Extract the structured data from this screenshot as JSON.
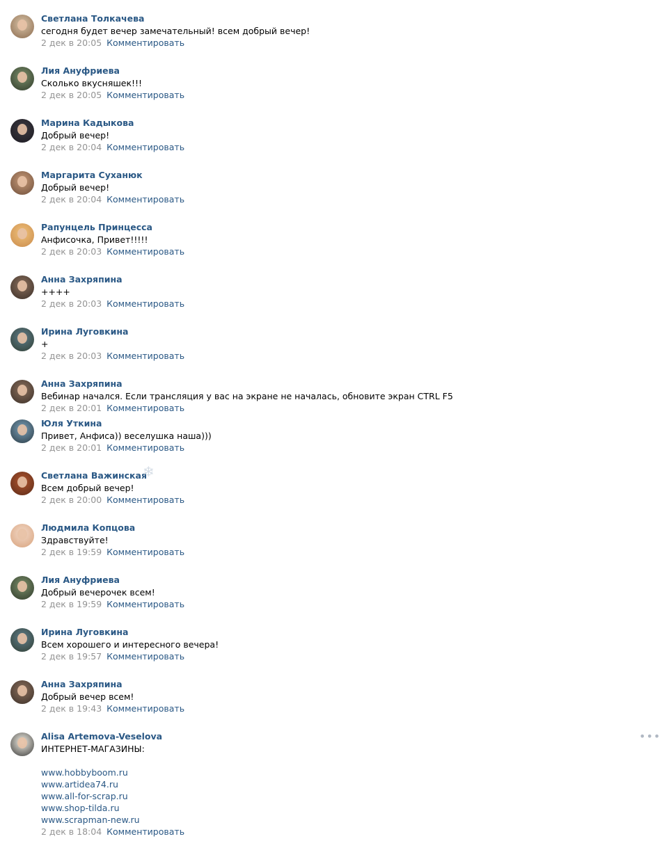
{
  "ui": {
    "reply_label": "Комментировать",
    "more_icon": "more-dots-icon",
    "decor_icon": "snowflake-icon"
  },
  "comments": [
    {
      "author": "Светлана Толкачева",
      "text": "сегодня будет вечер замечательный! всем добрый вечер!",
      "date": "2 дек в 20:05",
      "avatar_colors": [
        "#d9c4a8",
        "#8a6a4e"
      ]
    },
    {
      "author": "Лия Ануфриева",
      "text": "Сколько вкусняшек!!!",
      "date": "2 дек в 20:05",
      "avatar_colors": [
        "#7b8f6a",
        "#2f3a2a"
      ]
    },
    {
      "author": "Марина Кадыкова",
      "text": "Добрый вечер!",
      "date": "2 дек в 20:04",
      "avatar_colors": [
        "#3c3a40",
        "#1c1a22"
      ]
    },
    {
      "author": "Маргарита Суханюк",
      "text": "Добрый вечер!",
      "date": "2 дек в 20:04",
      "avatar_colors": [
        "#c79a78",
        "#6e4e3a"
      ]
    },
    {
      "author": "Рапунцель Принцесса",
      "text": "Анфисочка, Привет!!!!!",
      "date": "2 дек в 20:03",
      "avatar_colors": [
        "#f0c27b",
        "#c98a4b"
      ]
    },
    {
      "author": "Анна Захряпина",
      "text": "++++",
      "date": "2 дек в 20:03",
      "avatar_colors": [
        "#8a6f5c",
        "#3b2f28"
      ]
    },
    {
      "author": "Ирина Луговкина",
      "text": "+",
      "date": "2 дек в 20:03",
      "avatar_colors": [
        "#5f7d8a",
        "#2f3e33"
      ]
    },
    {
      "author": "Анна Захряпина",
      "text": "Вебинар начался. Если трансляция у вас на экране не началась, обновите экран CTRL F5",
      "date": "2 дек в 20:01",
      "avatar_colors": [
        "#8a6f5c",
        "#3b2f28"
      ]
    },
    {
      "author": "Юля Уткина",
      "text": "Привет, Анфиса)) веселушка наша)))",
      "date": "2 дек в 20:01",
      "avatar_colors": [
        "#7aa0b8",
        "#2a3a44"
      ]
    },
    {
      "author": "Светлана Важинская",
      "text": "Всем добрый вечер!",
      "date": "2 дек в 20:00",
      "avatar_colors": [
        "#b0552e",
        "#5a2a18"
      ]
    },
    {
      "author": "Людмила Копцова",
      "text": "Здравствуйте!",
      "date": "2 дек в 19:59",
      "avatar_colors": [
        "#f2d9c8",
        "#d8a27c"
      ]
    },
    {
      "author": "Лия Ануфриева",
      "text": "Добрый вечерочек всем!",
      "date": "2 дек в 19:59",
      "avatar_colors": [
        "#7b8f6a",
        "#2f3a2a"
      ]
    },
    {
      "author": "Ирина Луговкина",
      "text": "Всем хорошего и интересного вечера!",
      "date": "2 дек в 19:57",
      "avatar_colors": [
        "#5f7d8a",
        "#2f3e33"
      ]
    },
    {
      "author": "Анна Захряпина",
      "text": "Добрый вечер всем!",
      "date": "2 дек в 19:43",
      "avatar_colors": [
        "#8a6f5c",
        "#3b2f28"
      ]
    },
    {
      "author": "Alisa Artemova-Veselova",
      "text": "ИНТЕРНЕТ-МАГАЗИНЫ:",
      "links": [
        "www.hobbyboom.ru",
        "www.artidea74.ru",
        "www.all-for-scrap.ru",
        "www.shop-tilda.ru",
        "www.scrapman-new.ru"
      ],
      "date": "2 дек в 18:04",
      "avatar_colors": [
        "#f4f1e6",
        "#3a3a3a"
      ]
    }
  ]
}
